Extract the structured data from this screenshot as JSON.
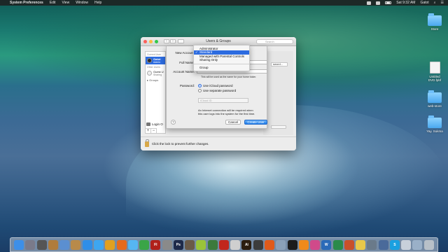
{
  "menubar": {
    "app_name": "System Preferences",
    "items": [
      "Edit",
      "View",
      "Window",
      "Help"
    ],
    "clock": "Sat 9:32 AM",
    "user": "Gatot"
  },
  "desktop_icons": [
    {
      "label": "Store",
      "type": "folder"
    },
    {
      "label": "Untitled DVD.fpbf",
      "type": "file"
    },
    {
      "label": "web-store",
      "type": "folder"
    },
    {
      "label": "Yay. Sukma",
      "type": "folder"
    }
  ],
  "window": {
    "title": "Users & Groups",
    "search_placeholder": "Search",
    "sidebar": {
      "current_user_header": "Current User",
      "current_user": {
        "name": "Gatot",
        "role": "Admin"
      },
      "other_users_header": "Other Users",
      "guest_user": {
        "name": "Guest U",
        "status": "Sharing"
      },
      "groups_label": "Groups",
      "login_options": "Login O",
      "add_label": "+",
      "remove_label": "−"
    },
    "background_button": "sword...",
    "lock_text": "Click the lock to prevent further changes."
  },
  "sheet": {
    "new_account_label": "New Account:",
    "full_name_label": "Full Name:",
    "account_name_label": "Account Name:",
    "account_name_hint": "This will be used as the name for your home folder.",
    "password_label": "Password:",
    "password_options": [
      {
        "label": "Use iCloud password",
        "selected": true
      },
      {
        "label": "Use separate password",
        "selected": false
      }
    ],
    "icloud_placeholder": "iCloud ID",
    "internet_note_1": "An Internet connection will be required when",
    "internet_note_2": "this user logs into the system for the first time.",
    "help_label": "?",
    "cancel_label": "Cancel",
    "create_label": "Create User"
  },
  "dropdown": {
    "items": [
      {
        "label": "Administrator",
        "checked": false,
        "highlighted": false
      },
      {
        "label": "Standard",
        "checked": true,
        "highlighted": true
      },
      {
        "label": "Managed with Parental Controls",
        "checked": false,
        "highlighted": false
      },
      {
        "label": "Sharing Only",
        "checked": false,
        "highlighted": false
      }
    ],
    "group_item": "Group",
    "check_glyph": "✓"
  },
  "dock": {
    "icons": [
      {
        "name": "finder-icon",
        "color": "#3d8fe8",
        "glyph": ""
      },
      {
        "name": "launchpad-icon",
        "color": "#7a7a8a",
        "glyph": ""
      },
      {
        "name": "rocket-icon",
        "color": "#555",
        "glyph": ""
      },
      {
        "name": "photos-icon",
        "color": "#b07c3c",
        "glyph": ""
      },
      {
        "name": "mail-icon",
        "color": "#5b8fd0",
        "glyph": ""
      },
      {
        "name": "contacts-icon",
        "color": "#b88a4a",
        "glyph": ""
      },
      {
        "name": "app-store-icon",
        "color": "#2f8ee8",
        "glyph": ""
      },
      {
        "name": "safari-icon",
        "color": "#3ea6f0",
        "glyph": ""
      },
      {
        "name": "chrome-icon",
        "color": "#e0a020",
        "glyph": ""
      },
      {
        "name": "firefox-icon",
        "color": "#e66a1c",
        "glyph": ""
      },
      {
        "name": "messages-icon",
        "color": "#56b6f2",
        "glyph": ""
      },
      {
        "name": "facetime-icon",
        "color": "#3aa547",
        "glyph": ""
      },
      {
        "name": "flash-icon",
        "color": "#b0201a",
        "glyph": "Fl"
      },
      {
        "name": "system-preferences-icon",
        "color": "#8a8a8a",
        "glyph": ""
      },
      {
        "name": "photoshop-icon",
        "color": "#1e2a4a",
        "glyph": "Ps"
      },
      {
        "name": "gimp-icon",
        "color": "#6a5a48",
        "glyph": ""
      },
      {
        "name": "android-icon",
        "color": "#9ac43a",
        "glyph": ""
      },
      {
        "name": "download-icon",
        "color": "#3c7a3c",
        "glyph": ""
      },
      {
        "name": "filezilla-icon",
        "color": "#c2261c",
        "glyph": ""
      },
      {
        "name": "reader-icon",
        "color": "#cfcfcf",
        "glyph": ""
      },
      {
        "name": "illustrator-icon",
        "color": "#2b1d0e",
        "glyph": "Ai"
      },
      {
        "name": "sublime-icon",
        "color": "#3c3c3c",
        "glyph": ""
      },
      {
        "name": "firefox-dev-icon",
        "color": "#e05a1a",
        "glyph": ""
      },
      {
        "name": "preview-icon",
        "color": "#8aa0b8",
        "glyph": ""
      },
      {
        "name": "terminal-icon",
        "color": "#1c1c1c",
        "glyph": ""
      },
      {
        "name": "vlc-icon",
        "color": "#f08a1a",
        "glyph": ""
      },
      {
        "name": "itunes-icon",
        "color": "#d04a8a",
        "glyph": ""
      },
      {
        "name": "word-icon",
        "color": "#2a6ab8",
        "glyph": "W"
      },
      {
        "name": "excel-icon",
        "color": "#2a8a4a",
        "glyph": ""
      },
      {
        "name": "powerpoint-icon",
        "color": "#c8502a",
        "glyph": ""
      },
      {
        "name": "notes-icon",
        "color": "#e8c84a",
        "glyph": ""
      },
      {
        "name": "utility-icon",
        "color": "#6a7a8a",
        "glyph": ""
      },
      {
        "name": "network-icon",
        "color": "#4a6a9a",
        "glyph": ""
      },
      {
        "name": "skype-icon",
        "color": "#1aa0e0",
        "glyph": "S"
      },
      {
        "name": "documents-icon",
        "color": "#c8d0da",
        "glyph": ""
      },
      {
        "name": "downloads-icon",
        "color": "#9ab0c8",
        "glyph": ""
      },
      {
        "name": "trash-icon",
        "color": "#b8c0c8",
        "glyph": ""
      }
    ]
  }
}
